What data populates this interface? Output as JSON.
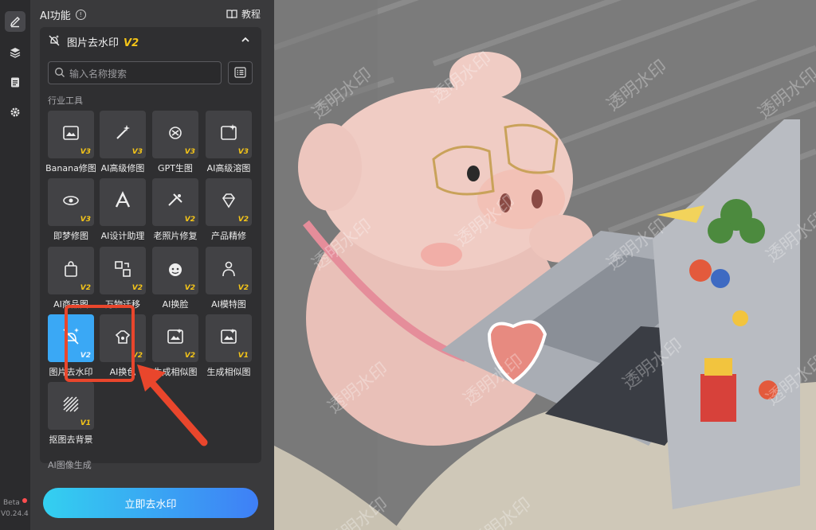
{
  "rail": {
    "icons": [
      "edit-icon",
      "layers-icon",
      "clipboard-icon",
      "settings-icon"
    ],
    "beta_label": "Beta",
    "version": "V0.24.4"
  },
  "panel": {
    "title": "AI功能",
    "tutorial_label": "教程",
    "tool_header": {
      "title": "图片去水印",
      "version": "V2"
    },
    "search_placeholder": "输入名称搜索",
    "section_industry": "行业工具",
    "section_image_gen": "AI图像生成",
    "tools": [
      {
        "label": "Banana修图",
        "badge": "V3",
        "icon": "image-edit-icon"
      },
      {
        "label": "AI高级修图",
        "badge": "V3",
        "icon": "magic-wand-icon"
      },
      {
        "label": "GPT生图",
        "badge": "V3",
        "icon": "gpt-icon"
      },
      {
        "label": "AI高级溶图",
        "badge": "V3",
        "icon": "image-sparkle-icon"
      },
      {
        "label": "即梦修图",
        "badge": "V3",
        "icon": "dream-icon"
      },
      {
        "label": "AI设计助理",
        "badge": "",
        "icon": "design-assistant-icon"
      },
      {
        "label": "老照片修复",
        "badge": "V2",
        "icon": "photo-restore-icon"
      },
      {
        "label": "产品精修",
        "badge": "V2",
        "icon": "diamond-icon"
      },
      {
        "label": "AI商品图",
        "badge": "V2",
        "icon": "shopping-bag-icon"
      },
      {
        "label": "万物迁移",
        "badge": "V2",
        "icon": "transfer-icon"
      },
      {
        "label": "AI换脸",
        "badge": "V2",
        "icon": "face-swap-icon"
      },
      {
        "label": "AI模特图",
        "badge": "V2",
        "icon": "model-icon"
      },
      {
        "label": "图片去水印",
        "badge": "V2",
        "icon": "watermark-remove-icon",
        "selected": true
      },
      {
        "label": "AI换色",
        "badge": "V2",
        "icon": "color-change-icon"
      },
      {
        "label": "生成相似图",
        "badge": "V2",
        "icon": "similar-image-icon"
      },
      {
        "label": "生成相似图",
        "badge": "V1",
        "icon": "similar-image-icon"
      },
      {
        "label": "抠图去背景",
        "badge": "V1",
        "icon": "background-remove-icon"
      }
    ],
    "action_button": "立即去水印"
  },
  "preview": {
    "watermark_text": "透明水印"
  },
  "colors": {
    "accent": "#3aa8f5",
    "badge": "#f5c518",
    "highlight": "#e9462c"
  }
}
